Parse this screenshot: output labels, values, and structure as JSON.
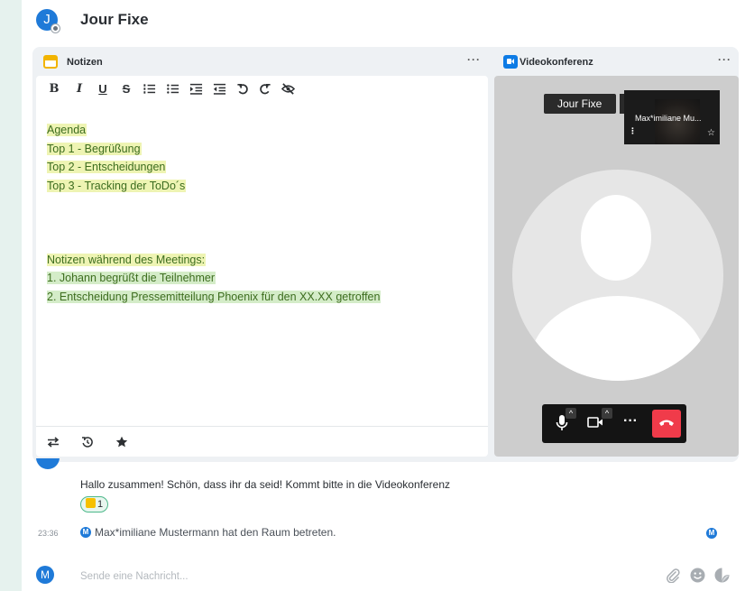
{
  "room": {
    "avatar_letter": "J",
    "title": "Jour Fixe"
  },
  "notes": {
    "title": "Notizen",
    "menu": "···",
    "toolbar": {
      "bold": "B",
      "italic": "I",
      "underline": "U",
      "strike": "S"
    },
    "lines": {
      "l1": "Agenda",
      "l2": "Top 1 - Begrüßung",
      "l3": "Top 2 - Entscheidungen",
      "l4": "Top 3 - Tracking der ToDo´s",
      "l5": "Notizen während des Meetings:",
      "l6": "1. Johann begrüßt die Teilnehmer",
      "l7": "2. Entscheidung Pressemitteilung Phoenix für den XX.XX getroffen"
    }
  },
  "video": {
    "title": "Videokonferenz",
    "menu": "···",
    "room_pill": "Jour Fixe",
    "participant_name": "Max*imiliane Mu...",
    "more": "···"
  },
  "timeline": {
    "message": "Hallo zusammen! Schön, dass ihr da seid! Kommt bitte in die Videokonferenz",
    "reaction_count": "1",
    "event_time": "23:36",
    "event_avatar": "M",
    "event_text": "Max*imiliane Mustermann  hat den Raum betreten.",
    "read_receipt": "M"
  },
  "composer": {
    "avatar_letter": "M",
    "placeholder": "Sende eine Nachricht..."
  }
}
